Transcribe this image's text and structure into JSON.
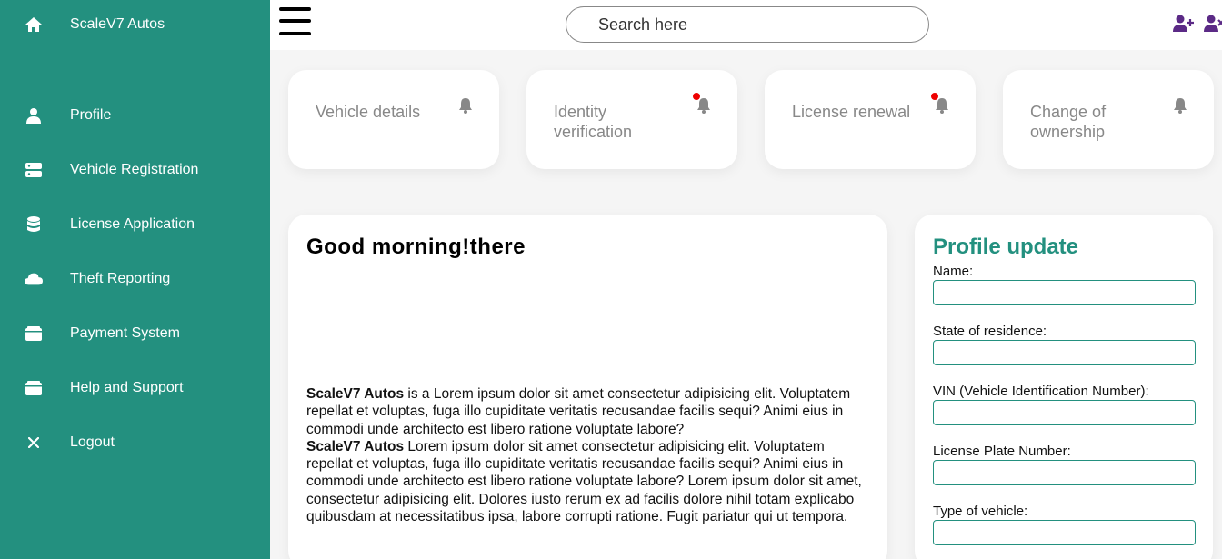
{
  "sidebar": {
    "brand": "ScaleV7 Autos",
    "items": [
      {
        "label": "Profile",
        "icon": "user-icon"
      },
      {
        "label": "Vehicle Registration",
        "icon": "server-icon"
      },
      {
        "label": "License Application",
        "icon": "database-icon"
      },
      {
        "label": "Theft Reporting",
        "icon": "cloud-icon"
      },
      {
        "label": "Payment System",
        "icon": "wallet-icon"
      },
      {
        "label": "Help and Support",
        "icon": "wallet-icon"
      },
      {
        "label": "Logout",
        "icon": "close-icon"
      }
    ],
    "bg_color": "#23907f"
  },
  "topbar": {
    "search_placeholder": "Search here",
    "icons": [
      "add-user-icon",
      "remove-user-icon"
    ],
    "icon_color": "#5b2a86"
  },
  "cards": [
    {
      "title": "Vehicle details",
      "notification": false
    },
    {
      "title": "Identity verification",
      "notification": true
    },
    {
      "title": "License renewal",
      "notification": true
    },
    {
      "title": "Change of ownership",
      "notification": false
    }
  ],
  "main": {
    "greeting": "Good morning!there",
    "brand_bold": "ScaleV7 Autos",
    "para1_rest": " is a Lorem ipsum dolor sit amet consectetur adipisicing elit. Voluptatem repellat et voluptas, fuga illo cupiditate veritatis recusandae facilis sequi? Animi eius in commodi unde architecto est libero ratione voluptate labore?",
    "para2_rest": " Lorem ipsum dolor sit amet consectetur adipisicing elit. Voluptatem repellat et voluptas, fuga illo cupiditate veritatis recusandae facilis sequi? Animi eius in commodi unde architecto est libero ratione voluptate labore? Lorem ipsum dolor sit amet, consectetur adipisicing elit. Dolores iusto rerum ex ad facilis dolore nihil totam explicabo quibusdam at necessitatibus ipsa, labore corrupti ratione. Fugit pariatur qui ut tempora."
  },
  "profile_update": {
    "title": "Profile update",
    "fields": [
      {
        "label": "Name:",
        "value": ""
      },
      {
        "label": "State of residence:",
        "value": ""
      },
      {
        "label": "VIN (Vehicle Identification Number):",
        "value": ""
      },
      {
        "label": "License Plate Number:",
        "value": ""
      },
      {
        "label": "Type of vehicle:",
        "value": ""
      }
    ],
    "accent_color": "#23907f"
  }
}
